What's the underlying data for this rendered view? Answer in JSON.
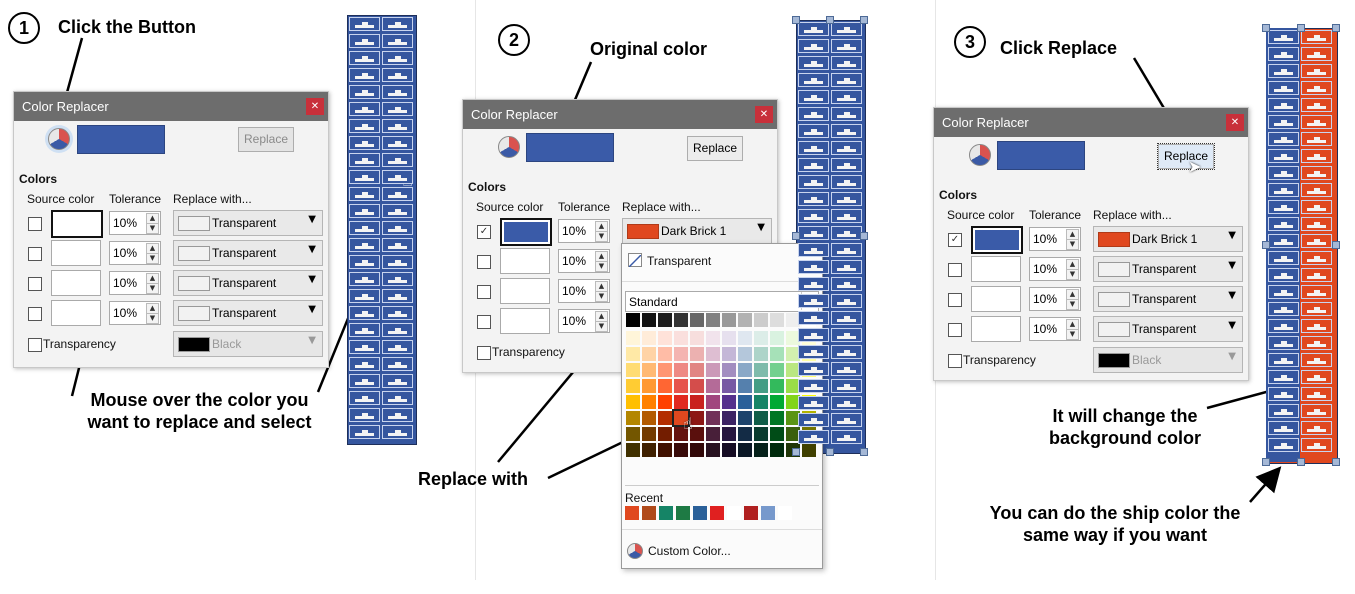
{
  "steps": [
    {
      "number": "1",
      "caption": "Click the Button"
    },
    {
      "number": "2",
      "caption": "Original color"
    },
    {
      "number": "3",
      "caption": "Click Replace"
    }
  ],
  "notes": {
    "mouse_over": "Mouse over the color you want to replace and select",
    "replace_with": "Replace with",
    "change_bg": "It will change the background color",
    "ship_color": "You can do the ship color the same way if you want"
  },
  "dialog": {
    "title": "Color Replacer",
    "replace_label": "Replace",
    "colors_heading": "Colors",
    "col_source": "Source color",
    "col_tolerance": "Tolerance",
    "col_replace": "Replace with...",
    "tolerance_value": "10%",
    "transparent": "Transparent",
    "dark_brick": "Dark Brick 1",
    "transparency_label": "Transparency",
    "black": "Black"
  },
  "palette": {
    "transparent": "Transparent",
    "scheme": "Standard",
    "recent": "Recent",
    "custom": "Custom Color..."
  },
  "colors": {
    "original": "#3a5ba8",
    "replacement": "#e0481f",
    "titlebar": "#6d6d6d"
  }
}
